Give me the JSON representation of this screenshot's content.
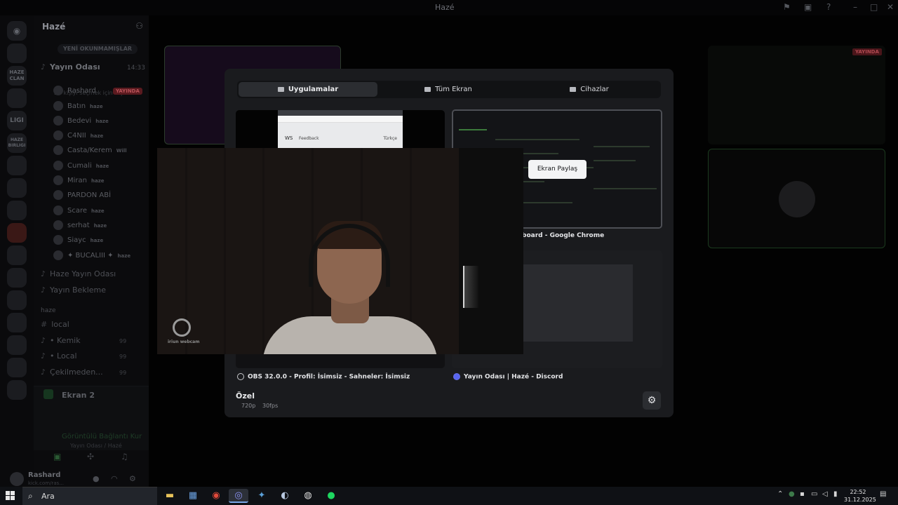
{
  "window": {
    "title": "Hazé"
  },
  "server": {
    "name": "Hazé",
    "unread_pill": "YENİ OKUNMAMIŞLAR"
  },
  "rail": {
    "labels": [
      "HAZE CLAN",
      "LIGI",
      "HAZE BIRLIGI"
    ]
  },
  "voice_channel": {
    "name": "Yayın Odası",
    "time": "14:33",
    "subtitle": "Bir kişiyi seçmek için taşı",
    "members": [
      {
        "name": "Rashard",
        "tag": "",
        "live": "YAYINDA"
      },
      {
        "name": "Batın",
        "tag": "haze"
      },
      {
        "name": "Bedevi",
        "tag": "haze"
      },
      {
        "name": "C4NII",
        "tag": "haze"
      },
      {
        "name": "Casta/Kerem",
        "tag": "Will"
      },
      {
        "name": "Cumali",
        "tag": "haze"
      },
      {
        "name": "Miran",
        "tag": "haze"
      },
      {
        "name": "PARDON ABİ",
        "tag": ""
      },
      {
        "name": "Scare",
        "tag": "haze"
      },
      {
        "name": "serhat",
        "tag": "haze"
      },
      {
        "name": "Siayc",
        "tag": "haze"
      },
      {
        "name": "✦ BUCALIII ✦",
        "tag": "haze"
      }
    ]
  },
  "channels": {
    "haze_yayin": "Haze Yayın Odası",
    "yayin_bekleme": "Yayın Bekleme",
    "category": "haze",
    "local": "local",
    "kemik": "• Kemik",
    "local2": "• Local",
    "cekilmeden": "Çekilmeden...",
    "badge": "99"
  },
  "voice_panel": {
    "screen": "Ekran 2",
    "status": "Görüntülü Bağlantı Kur",
    "location": "Yayın Odası / Hazé"
  },
  "user": {
    "name": "Rashard",
    "sub": "kick.com/ras..."
  },
  "background": {
    "live_badge": "YAYINDA"
  },
  "modal": {
    "tabs": [
      {
        "label": "Uygulamalar",
        "active": true
      },
      {
        "label": "Tüm Ekran",
        "active": false
      },
      {
        "label": "Cihazlar",
        "active": false
      }
    ],
    "thumbs": {
      "browser_ws": "WS",
      "browser_feedback": "Feedback",
      "browser_lang": "Türkçe",
      "chrome_label": "board - Google Chrome",
      "obs_label": "OBS 32.0.0 - Profil: İsimsiz - Sahneler: İsimsiz",
      "discord_label": "Yayın Odası | Hazé - Discord"
    },
    "tooltip": "Ekran Paylaş",
    "quality_title": "Özel",
    "resolution": "720p",
    "fps": "30fps"
  },
  "webcam": {
    "brand": "iriun webcam"
  },
  "taskbar": {
    "search_placeholder": "Ara",
    "time": "22:52",
    "date": "31.12.2025",
    "apps": [
      "file-explorer-icon",
      "calculator-icon",
      "chrome-icon",
      "discord-icon",
      "tool-icon",
      "steam-icon",
      "obs-icon",
      "spotify-icon"
    ]
  }
}
